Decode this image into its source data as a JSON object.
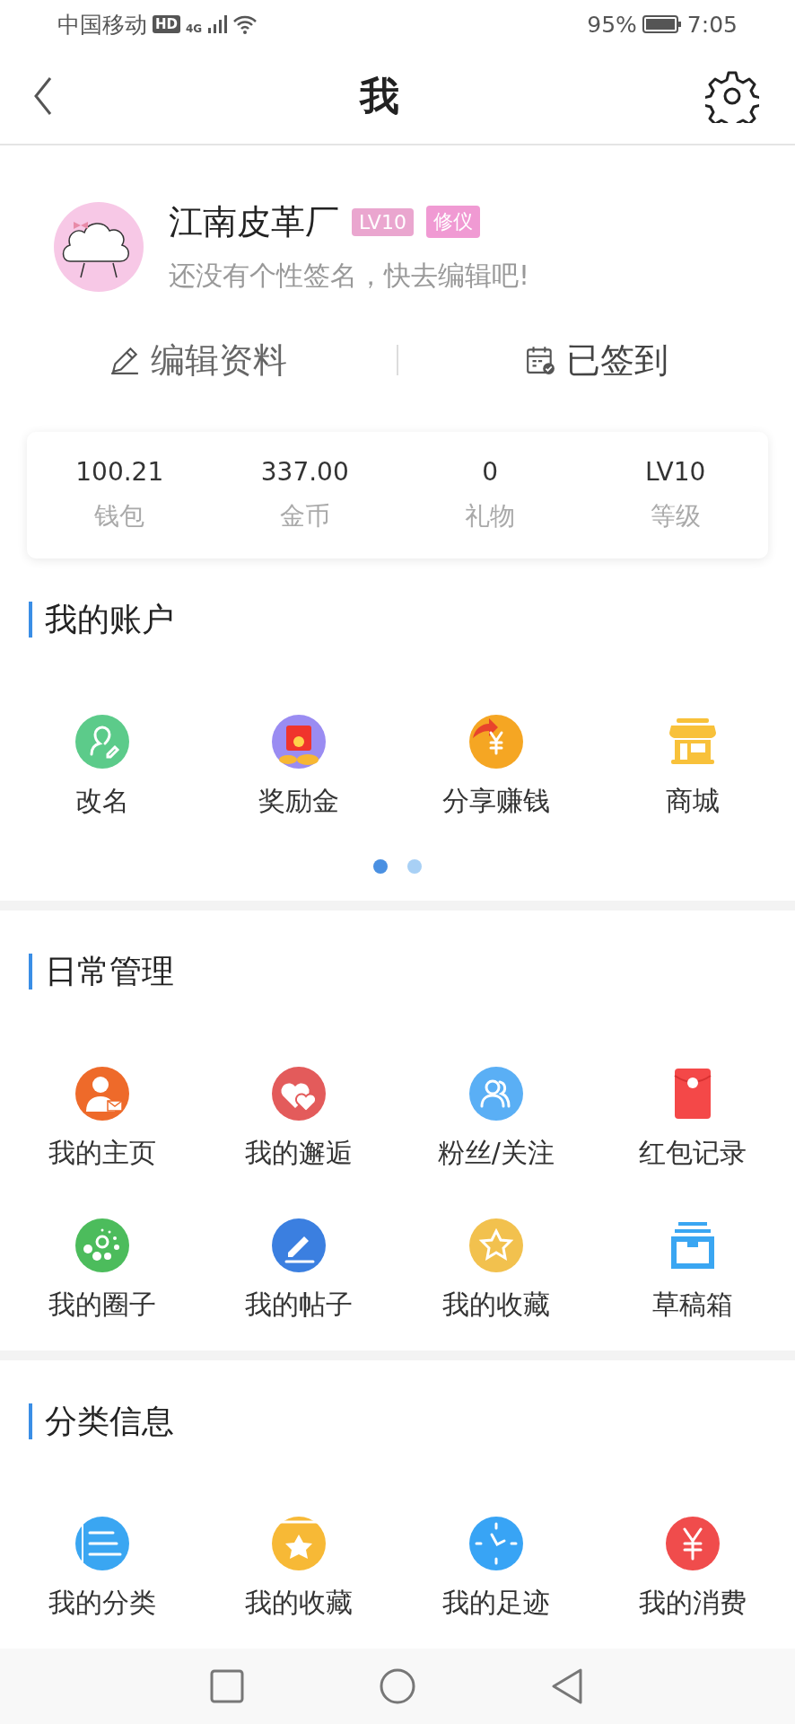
{
  "status_bar": {
    "carrier": "中国移动",
    "hd": "HD",
    "network": "4G",
    "battery": "95%",
    "time": "7:05"
  },
  "header": {
    "title": "我"
  },
  "profile": {
    "name": "江南皮革厂",
    "signature": "还没有个性签名，快去编辑吧!",
    "badges": [
      {
        "label": "LV10",
        "color": "#eaa6cf"
      },
      {
        "label": "修仪",
        "color": "#f09ad3"
      }
    ]
  },
  "actions": [
    {
      "label": "编辑资料"
    },
    {
      "label": "已签到"
    }
  ],
  "stats": [
    {
      "value": "100.21",
      "label": "钱包"
    },
    {
      "value": "337.00",
      "label": "金币"
    },
    {
      "value": "0",
      "label": "礼物"
    },
    {
      "value": "LV10",
      "label": "等级"
    }
  ],
  "sections": [
    {
      "title": "我的账户",
      "items": [
        {
          "label": "改名"
        },
        {
          "label": "奖励金"
        },
        {
          "label": "分享赚钱"
        },
        {
          "label": "商城"
        }
      ],
      "pager": [
        {
          "selected": true
        },
        {
          "selected": false
        }
      ]
    },
    {
      "title": "日常管理",
      "items": [
        {
          "label": "我的主页"
        },
        {
          "label": "我的邂逅"
        },
        {
          "label": "粉丝/关注"
        },
        {
          "label": "红包记录"
        },
        {
          "label": "我的圈子"
        },
        {
          "label": "我的帖子"
        },
        {
          "label": "我的收藏"
        },
        {
          "label": "草稿箱"
        }
      ]
    },
    {
      "title": "分类信息",
      "items": [
        {
          "label": "我的分类"
        },
        {
          "label": "我的收藏"
        },
        {
          "label": "我的足迹"
        },
        {
          "label": "我的消费"
        }
      ]
    }
  ]
}
